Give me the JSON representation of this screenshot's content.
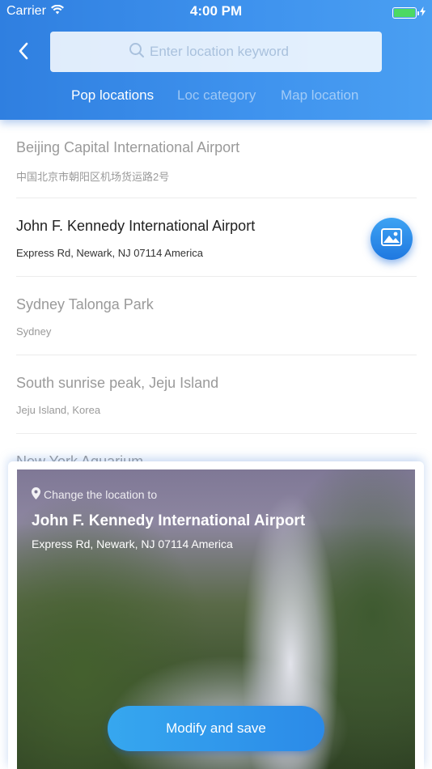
{
  "status_bar": {
    "carrier": "Carrier",
    "time": "4:00 PM",
    "battery_level": 1.0,
    "wifi_icon": "wifi-icon",
    "charging_icon": "bolt-icon"
  },
  "header": {
    "back_icon": "chevron-left-icon",
    "search": {
      "placeholder": "Enter location keyword",
      "value": "",
      "icon": "search-icon"
    },
    "tabs": [
      {
        "label": "Pop locations",
        "active": true
      },
      {
        "label": "Loc category",
        "active": false
      },
      {
        "label": "Map location",
        "active": false
      }
    ]
  },
  "locations": [
    {
      "name": "Beijing Capital International Airport",
      "address": "中国北京市朝阳区机场货运路2号",
      "selected": false
    },
    {
      "name": "John F. Kennedy International Airport",
      "address": "Express Rd, Newark, NJ 07114 America",
      "selected": true
    },
    {
      "name": "Sydney Talonga Park",
      "address": "Sydney",
      "selected": false
    },
    {
      "name": "South sunrise peak, Jeju Island",
      "address": "Jeju Island, Korea",
      "selected": false
    },
    {
      "name": "New York Aquarium",
      "address": "",
      "selected": false
    }
  ],
  "fab": {
    "icon": "image-icon"
  },
  "sheet": {
    "change_label": "Change the location to",
    "pin_icon": "location-pin-icon",
    "title": "John F. Kennedy International Airport",
    "address": "Express Rd, Newark, NJ 07114 America",
    "save_label": "Modify and save"
  },
  "colors": {
    "accent": "#2f7fe0",
    "accent_light": "#4a9ff2",
    "text_primary": "#222222",
    "text_muted": "#9a9a9a"
  }
}
